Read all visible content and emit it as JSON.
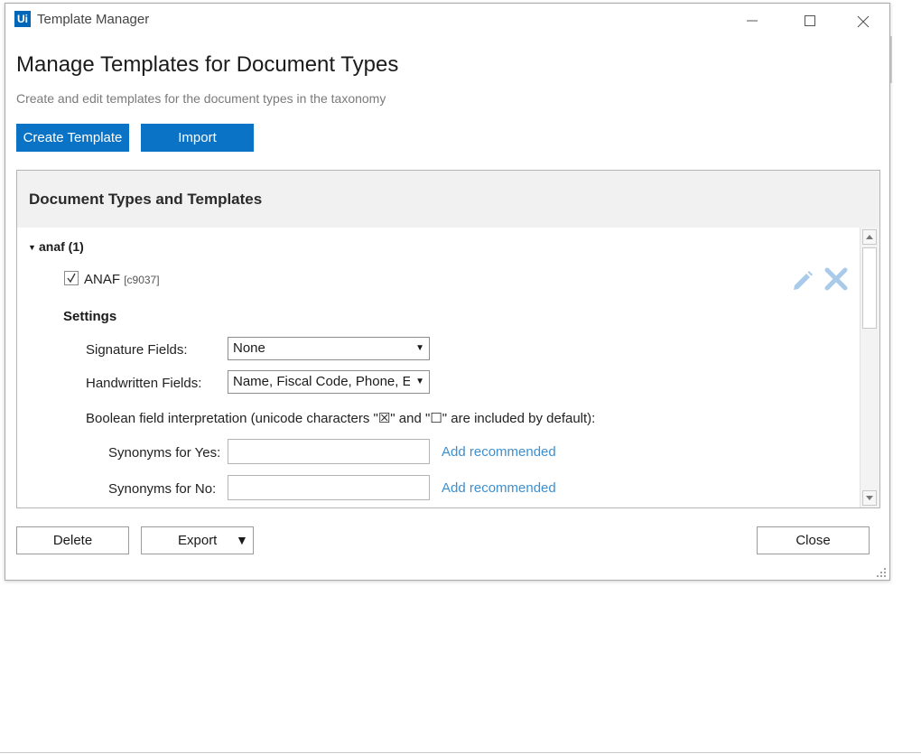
{
  "window": {
    "title": "Template Manager",
    "logo_text": "Ui"
  },
  "page": {
    "heading": "Manage Templates for Document Types",
    "subheading": "Create and edit templates for the document types in the taxonomy"
  },
  "toolbar": {
    "create_label": "Create Template",
    "import_label": "Import"
  },
  "panel": {
    "title": "Document Types and Templates",
    "group": {
      "toggle": "▼",
      "label": "anaf (1)"
    },
    "template": {
      "checked": true,
      "name": "ANAF",
      "id": "[c9037]"
    },
    "settings": {
      "label": "Settings",
      "signature_label": "Signature Fields:",
      "signature_value": "None",
      "handwritten_label": "Handwritten Fields:",
      "handwritten_value": "Name, Fiscal Code, Phone, E-mail",
      "boolean_text": "Boolean field interpretation (unicode characters \"☒\" and \"☐\" are included by default):",
      "yes_label": "Synonyms for Yes:",
      "yes_value": "",
      "no_label": "Synonyms for No:",
      "no_value": "",
      "add_recommended_yes": "Add recommended",
      "add_recommended_no": "Add recommended"
    }
  },
  "footer": {
    "delete_label": "Delete",
    "export_label": "Export",
    "export_arrow": "▼",
    "close_label": "Close"
  },
  "colors": {
    "accent": "#0b73c6",
    "link": "#3c8fd0",
    "icon_light": "#a9cbe9"
  }
}
